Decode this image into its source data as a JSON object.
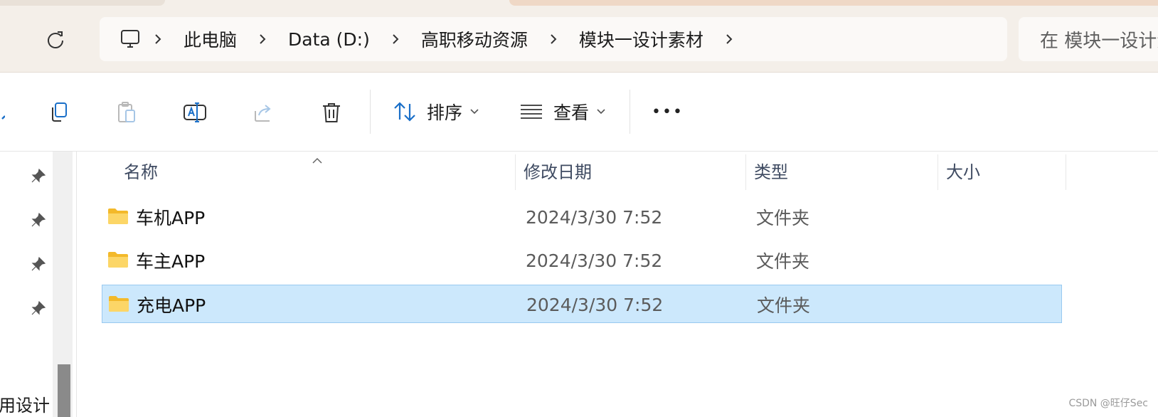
{
  "breadcrumb": {
    "items": [
      "此电脑",
      "Data (D:)",
      "高职移动资源",
      "模块一设计素材"
    ]
  },
  "search": {
    "placeholder": "在 模块一设计素材 中搜索"
  },
  "toolbar": {
    "sort_label": "排序",
    "view_label": "查看",
    "more_label": "•••"
  },
  "columns": {
    "name": "名称",
    "modified": "修改日期",
    "type": "类型",
    "size": "大小"
  },
  "files": [
    {
      "name": "车机APP",
      "modified": "2024/3/30 7:52",
      "type": "文件夹",
      "selected": false
    },
    {
      "name": "车主APP",
      "modified": "2024/3/30 7:52",
      "type": "文件夹",
      "selected": false
    },
    {
      "name": "充电APP",
      "modified": "2024/3/30 7:52",
      "type": "文件夹",
      "selected": true
    }
  ],
  "nav": {
    "cut_label": "用设计"
  },
  "watermark": "CSDN @旺仔Sec",
  "colors": {
    "selection": "#cce8fc",
    "accent": "#1a6fc8",
    "folder": "#f7c948"
  }
}
